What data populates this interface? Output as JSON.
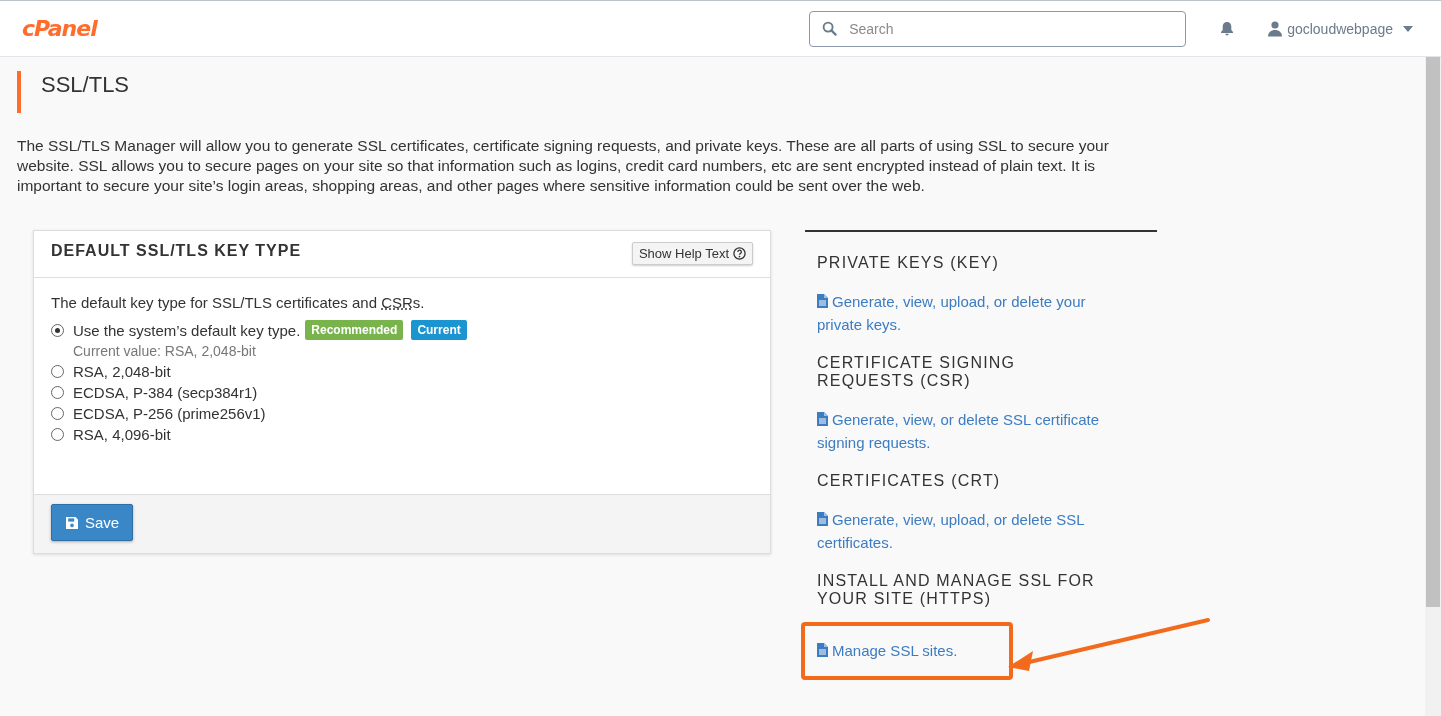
{
  "header": {
    "logo": "cPanel",
    "search": {
      "placeholder": "Search"
    },
    "user": {
      "name": "gocloudwebpage"
    }
  },
  "page": {
    "title": "SSL/TLS",
    "description": "The SSL/TLS Manager will allow you to generate SSL certificates, certificate signing requests, and private keys. These are all parts of using SSL to secure your website. SSL allows you to secure pages on your site so that information such as logins, credit card numbers, etc are sent encrypted instead of plain text. It is important to secure your site’s login areas, shopping areas, and other pages where sensitive information could be sent over the web."
  },
  "key_type_card": {
    "title": "DEFAULT SSL/TLS KEY TYPE",
    "help_button": "Show Help Text",
    "intro_before": "The default key type for SSL/TLS certificates and ",
    "intro_abbr": "CSR",
    "intro_after": "s.",
    "options": [
      {
        "label": "Use the system’s default key type.",
        "selected": true,
        "badges": [
          {
            "text": "Recommended",
            "color": "#78b34c"
          },
          {
            "text": "Current",
            "color": "#1b95d0"
          }
        ],
        "note": "Current value: RSA, 2,048-bit"
      },
      {
        "label": "RSA, 2,048-bit",
        "selected": false
      },
      {
        "label": "ECDSA, P-384 (secp384r1)",
        "selected": false
      },
      {
        "label": "ECDSA, P-256 (prime256v1)",
        "selected": false
      },
      {
        "label": "RSA, 4,096-bit",
        "selected": false
      }
    ],
    "save_button": "Save"
  },
  "sections": [
    {
      "title": "PRIVATE KEYS (KEY)",
      "link": "Generate, view, upload, or delete your private keys.",
      "highlighted": false
    },
    {
      "title": "CERTIFICATE SIGNING REQUESTS (CSR)",
      "link": "Generate, view, or delete SSL certificate signing requests.",
      "highlighted": false
    },
    {
      "title": "CERTIFICATES (CRT)",
      "link": "Generate, view, upload, or delete SSL certificates.",
      "highlighted": false
    },
    {
      "title": "INSTALL AND MANAGE SSL FOR YOUR SITE (HTTPS)",
      "link": "Manage SSL sites.",
      "highlighted": true
    }
  ]
}
